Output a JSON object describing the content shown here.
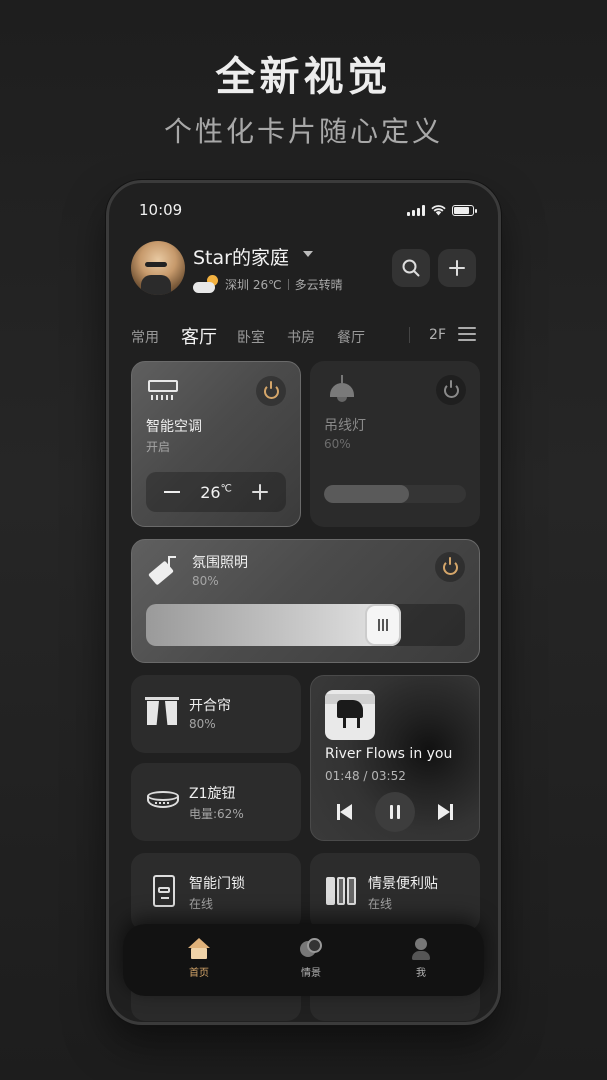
{
  "hero": {
    "title": "全新视觉",
    "subtitle": "个性化卡片随心定义"
  },
  "status_bar": {
    "time": "10:09"
  },
  "header": {
    "home_name": "Star的家庭",
    "weather": {
      "location_temp": "深圳 26℃",
      "condition": "多云转晴"
    }
  },
  "tabs": {
    "items": [
      "常用",
      "客厅",
      "卧室",
      "书房",
      "餐厅"
    ],
    "active": "客厅",
    "floor": "2F"
  },
  "devices": {
    "ac": {
      "name": "智能空调",
      "status": "开启",
      "temp_value": "26",
      "temp_unit": "℃"
    },
    "pendant_lamp": {
      "name": "吊线灯",
      "brightness_text": "60%",
      "brightness": 0.6
    },
    "ambient_light": {
      "name": "氛围照明",
      "brightness_text": "80%",
      "brightness": 0.8
    },
    "curtain": {
      "name": "开合帘",
      "status": "80%"
    },
    "knob": {
      "name": "Z1旋钮",
      "status": "电量:62%"
    },
    "door_lock": {
      "name": "智能门锁",
      "status": "在线"
    },
    "scene_sticker": {
      "name": "情景便利贴",
      "status": "在线"
    }
  },
  "music": {
    "song": "River Flows in you",
    "time": "01:48 / 03:52"
  },
  "bottom_nav": {
    "items": [
      "首页",
      "情景",
      "我"
    ],
    "active": "首页"
  },
  "colors": {
    "accent": "#d5a66a",
    "background": "#202020"
  }
}
